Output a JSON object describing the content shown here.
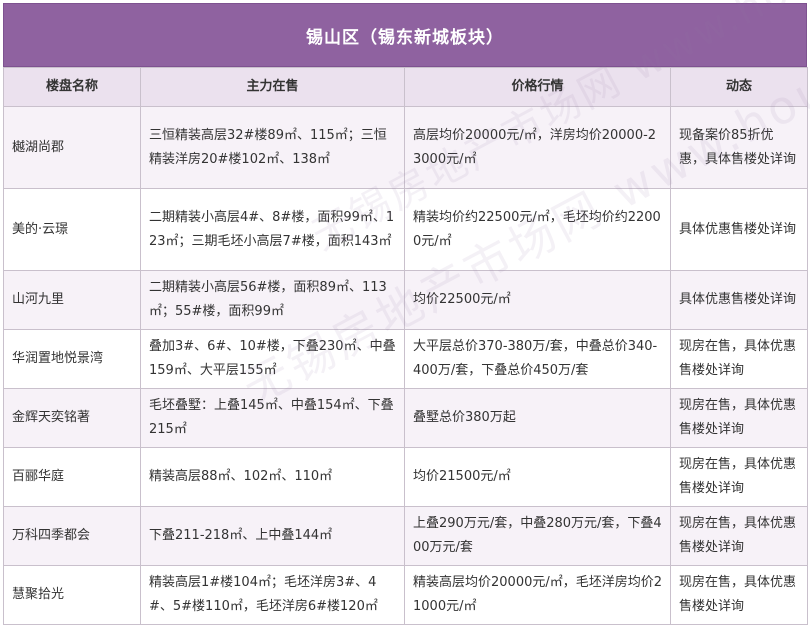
{
  "title": "锡山区（锡东新城板块）",
  "headers": [
    "楼盘名称",
    "主力在售",
    "价格行情",
    "动态"
  ],
  "rows": [
    {
      "name": "樾湖尚郡",
      "supply": "三恒精装高层32#楼89㎡、115㎡；三恒精装洋房20#楼102㎡、138㎡",
      "price": "高层均价20000元/㎡，洋房均价20000-23000元/㎡",
      "status": "现备案价85折优惠，具体售楼处详询"
    },
    {
      "name": "美的·云璟",
      "supply": "二期精装小高层4#、8#楼，面积99㎡、123㎡；三期毛坯小高层7#楼，面积143㎡",
      "price": "精装均价约22500元/㎡，毛坯均价约22000元/㎡",
      "status": "具体优惠售楼处详询"
    },
    {
      "name": "山河九里",
      "supply": "二期精装小高层56#楼，面积89㎡、113㎡；55#楼，面积99㎡",
      "price": "均价22500元/㎡",
      "status": "具体优惠售楼处详询"
    },
    {
      "name": "华润置地悦景湾",
      "supply": "叠加3#、6#、10#楼，下叠230㎡、中叠159㎡、大平层155㎡",
      "price": "大平层总价370-380万/套，中叠总价340-400万/套，下叠总价450万/套",
      "status": "现房在售，具体优惠售楼处详询"
    },
    {
      "name": "金辉天奕铭著",
      "supply": "毛坯叠墅：上叠145㎡、中叠154㎡、下叠215㎡",
      "price": "叠墅总价380万起",
      "status": "现房在售，具体优惠售楼处详询"
    },
    {
      "name": "百郦华庭",
      "supply": "精装高层88㎡、102㎡、110㎡",
      "price": "均价21500元/㎡",
      "status": "现房在售，具体优惠售楼处详询"
    },
    {
      "name": "万科四季都会",
      "supply": "下叠211-218㎡、上中叠144㎡",
      "price": "上叠290万元/套，中叠280万元/套，下叠400万元/套",
      "status": "现房在售，具体优惠售楼处详询"
    },
    {
      "name": "慧聚拾光",
      "supply": "精装高层1#楼104㎡；毛坯洋房3#、4#、5#楼110㎡，毛坯洋房6#楼120㎡",
      "price": "精装高层均价20000元/㎡，毛坯洋房均价21000元/㎡",
      "status": "现房在售，具体优惠售楼处详询"
    }
  ],
  "watermark": "无锡房地产市场网 www.house.com"
}
